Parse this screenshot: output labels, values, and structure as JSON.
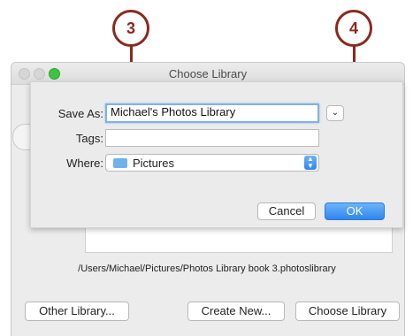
{
  "callouts": {
    "step3": "3",
    "step4": "4"
  },
  "window": {
    "title": "Choose Library"
  },
  "sheet": {
    "save_as_label": "Save As:",
    "save_as_value": "Michael's Photos Library",
    "tags_label": "Tags:",
    "tags_value": "",
    "where_label": "Where:",
    "where_value": "Pictures",
    "cancel_label": "Cancel",
    "ok_label": "OK"
  },
  "library_path": "/Users/Michael/Pictures/Photos Library book 3.photoslibrary",
  "buttons": {
    "other_library": "Other Library...",
    "create_new": "Create New...",
    "choose_library": "Choose Library"
  },
  "colors": {
    "callout": "#8a2a1e",
    "accent": "#2e86ee",
    "focus_ring": "#7db2ea"
  }
}
